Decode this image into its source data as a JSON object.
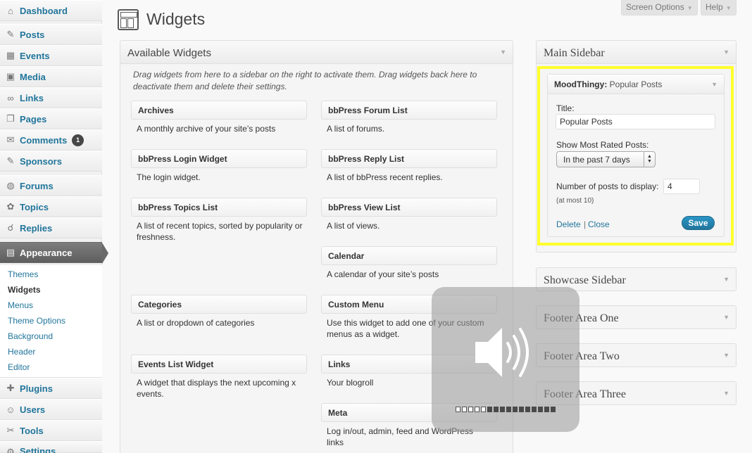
{
  "admin_menu": {
    "items": [
      {
        "label": "Dashboard",
        "icon": "dashboard-icon",
        "glyph": "⌂"
      },
      {
        "label": "Posts",
        "icon": "pushpin-icon",
        "glyph": "✎"
      },
      {
        "label": "Events",
        "icon": "calendar-icon",
        "glyph": "▦"
      },
      {
        "label": "Media",
        "icon": "media-icon",
        "glyph": "▣"
      },
      {
        "label": "Links",
        "icon": "link-icon",
        "glyph": "∞"
      },
      {
        "label": "Pages",
        "icon": "pages-icon",
        "glyph": "❐"
      },
      {
        "label": "Comments",
        "icon": "comment-icon",
        "glyph": "✉",
        "badge": "1"
      },
      {
        "label": "Sponsors",
        "icon": "pushpin-icon",
        "glyph": "✎"
      },
      {
        "label": "Forums",
        "icon": "forum-icon",
        "glyph": "◍"
      },
      {
        "label": "Topics",
        "icon": "topics-icon",
        "glyph": "✿"
      },
      {
        "label": "Replies",
        "icon": "replies-icon",
        "glyph": "☌"
      },
      {
        "label": "Appearance",
        "icon": "appearance-icon",
        "glyph": "▤"
      },
      {
        "label": "Plugins",
        "icon": "plugin-icon",
        "glyph": "✚"
      },
      {
        "label": "Users",
        "icon": "users-icon",
        "glyph": "☺"
      },
      {
        "label": "Tools",
        "icon": "tools-icon",
        "glyph": "✂"
      },
      {
        "label": "Settings",
        "icon": "settings-icon",
        "glyph": "⚙"
      }
    ],
    "submenu": [
      "Themes",
      "Widgets",
      "Menus",
      "Theme Options",
      "Background",
      "Header",
      "Editor"
    ]
  },
  "header": {
    "title": "Widgets",
    "screen_options": "Screen Options",
    "help": "Help"
  },
  "available": {
    "title": "Available Widgets",
    "description": "Drag widgets from here to a sidebar on the right to activate them. Drag widgets back here to deactivate them and delete their settings.",
    "widgets": [
      {
        "name": "Archives",
        "desc": "A monthly archive of your site’s posts"
      },
      {
        "name": "bbPress Forum List",
        "desc": "A list of forums."
      },
      {
        "name": "bbPress Login Widget",
        "desc": "The login widget."
      },
      {
        "name": "bbPress Reply List",
        "desc": "A list of bbPress recent replies."
      },
      {
        "name": "bbPress Topics List",
        "desc": "A list of recent topics, sorted by popularity or freshness."
      },
      {
        "name": "bbPress View List",
        "desc": "A list of views."
      },
      {
        "name": "Calendar",
        "desc": "A calendar of your site’s posts"
      },
      {
        "name": "Categories",
        "desc": "A list or dropdown of categories"
      },
      {
        "name": "Custom Menu",
        "desc": "Use this widget to add one of your custom menus as a widget."
      },
      {
        "name": "Events List Widget",
        "desc": "A widget that displays the next upcoming x events."
      },
      {
        "name": "Links",
        "desc": "Your blogroll"
      },
      {
        "name": "Meta",
        "desc": "Log in/out, admin, feed and WordPress links"
      }
    ]
  },
  "main_sidebar": {
    "title": "Main Sidebar",
    "widget": {
      "name": "MoodThingy:",
      "instance_title": "Popular Posts",
      "title_label": "Title:",
      "title_value": "Popular Posts",
      "rated_label": "Show Most Rated Posts:",
      "rated_value": "In the past 7 days",
      "count_label": "Number of posts to display:",
      "count_value": "4",
      "count_hint": "(at most 10)",
      "delete_label": "Delete",
      "separator": "|",
      "close_label": "Close",
      "save_label": "Save"
    }
  },
  "other_sidebars": [
    "Showcase Sidebar",
    "Footer Area One",
    "Footer Area Two",
    "Footer Area Three"
  ],
  "volume_overlay": {
    "icon": "speaker-icon",
    "level": 0.31,
    "segments": 16
  },
  "colors": {
    "link": "#21759b",
    "highlight": "#ffff2a",
    "current_menu": "#6d6d6d"
  }
}
